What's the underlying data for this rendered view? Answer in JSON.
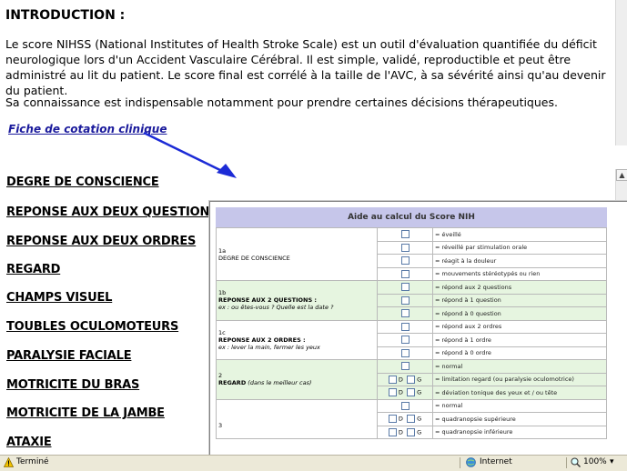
{
  "intro": {
    "title": "INTRODUCTION :",
    "paragraph1": "Le score NIHSS (National Institutes of Health Stroke Scale) est un outil d'évaluation quantifiée du déficit neurologique lors d'un Accident Vasculaire Cérébral. Il est simple, validé, reproductible et peut être administré au lit du patient. Le score final est corrélé à la taille de l'AVC, à sa sévérité ainsi qu'au devenir du patient.",
    "paragraph2": "Sa connaissance est indispensable notamment pour prendre certaines décisions thérapeutiques.",
    "link": "Fiche de cotation clinique"
  },
  "nav": {
    "items": [
      "DEGRE DE CONSCIENCE",
      "REPONSE AUX DEUX QUESTIONS",
      "REPONSE AUX DEUX ORDRES",
      "REGARD",
      "CHAMPS VISUEL",
      "TOUBLES OCULOMOTEURS",
      "PARALYSIE FACIALE",
      "MOTRICITE DU BRAS",
      "MOTRICITE DE LA JAMBE",
      "ATAXIE"
    ]
  },
  "popup": {
    "title": "Aide au calcul du Score NIH",
    "sections": [
      {
        "num": "1a",
        "label": "DEGRE DE CONSCIENCE",
        "sub": "",
        "options": [
          "= éveillé",
          "= réveillé par stimulation orale",
          "= réagit à la douleur",
          "= mouvements stéréotypés ou rien"
        ]
      },
      {
        "num": "1b",
        "label": "REPONSE AUX 2 QUESTIONS :",
        "sub": "ex : ou êtes-vous ? Quelle est la date ?",
        "options": [
          "= répond aux 2 questions",
          "= répond à 1 question",
          "= répond à 0 question"
        ]
      },
      {
        "num": "1c",
        "label": "REPONSE AUX 2 ORDRES :",
        "sub": "ex : lever la main, fermer les yeux",
        "options": [
          "= répond aux 2 ordres",
          "= répond à 1 ordre",
          "= répond à 0 ordre"
        ]
      },
      {
        "num": "2",
        "label": "REGARD",
        "sub": "(dans le meilleur cas)",
        "options": [
          "= normal",
          "= limitation regard (ou paralysie oculomotrice)",
          "= déviation tonique des yeux et / ou tête"
        ]
      },
      {
        "num": "3",
        "label": "",
        "sub": "",
        "options": [
          "= normal",
          "= quadranopsie supérieure",
          "= quadranopsie inférieure"
        ]
      }
    ],
    "d_label": "D",
    "g_label": "G"
  },
  "statusbar": {
    "status": "Terminé",
    "zone": "Internet",
    "zoom": "100%"
  }
}
